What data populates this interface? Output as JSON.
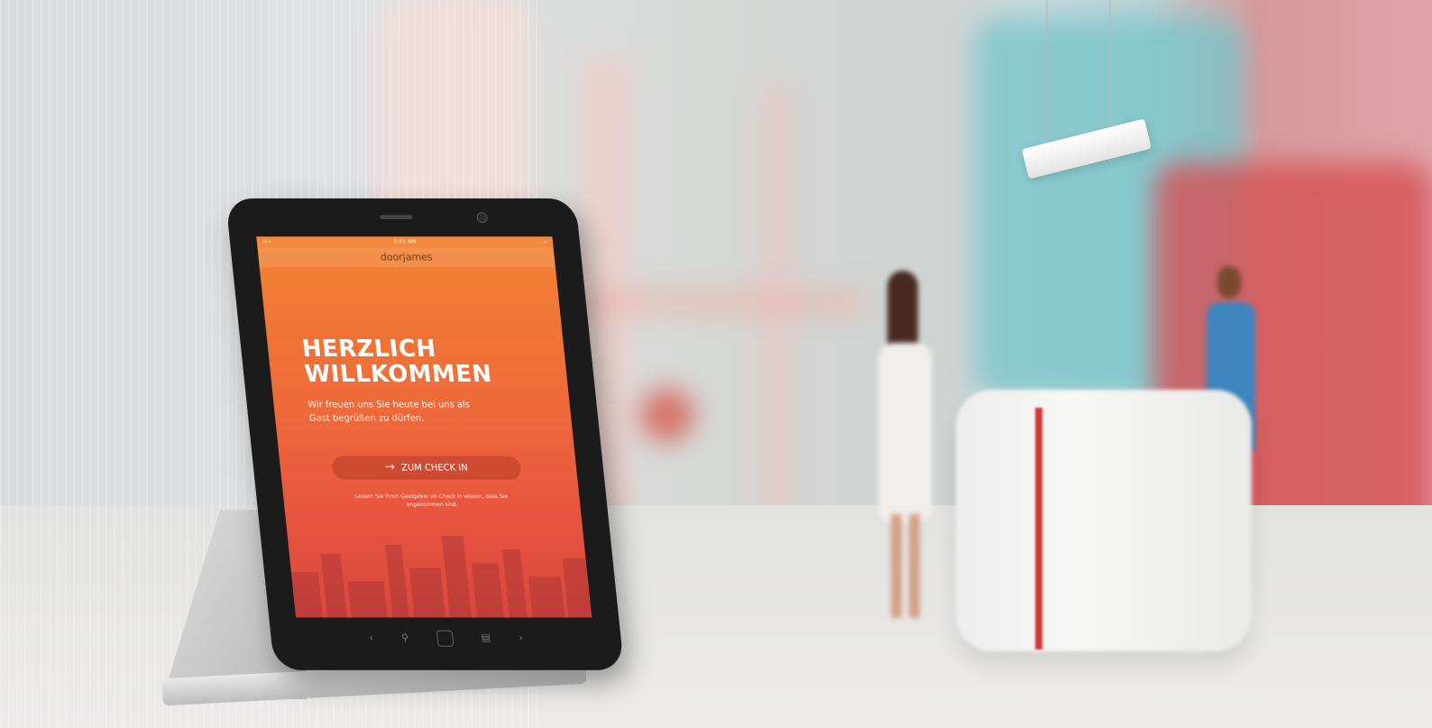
{
  "scene": {
    "description_colors": {
      "screen_gradient_top": "#f28332",
      "screen_gradient_bottom": "#d8483f",
      "desk_stripe": "#d13a3a",
      "wall_teal": "#7ec4cb",
      "wall_red": "#d84a4f"
    }
  },
  "tablet": {
    "status": {
      "left": "ııll ▾",
      "center": "9:41 AM",
      "right": "▭"
    },
    "app_name": "doorjames",
    "welcome_title_line1": "HERZLICH",
    "welcome_title_line2": "WILLKOMMEN",
    "welcome_subtitle": "Wir freuen uns Sie heute bei uns als Gast begrüßen zu dürfen.",
    "checkin_button": {
      "icon": "arrow-right-icon",
      "arrow": "→",
      "label": "ZUM CHECK IN"
    },
    "checkin_note": "Lassen Sie Ihren Gastgeber im Check in wissen, dass Sie angekommen sind.",
    "nav": {
      "back": "‹",
      "search": "⚲",
      "menu": "▤",
      "forward": "›"
    }
  }
}
